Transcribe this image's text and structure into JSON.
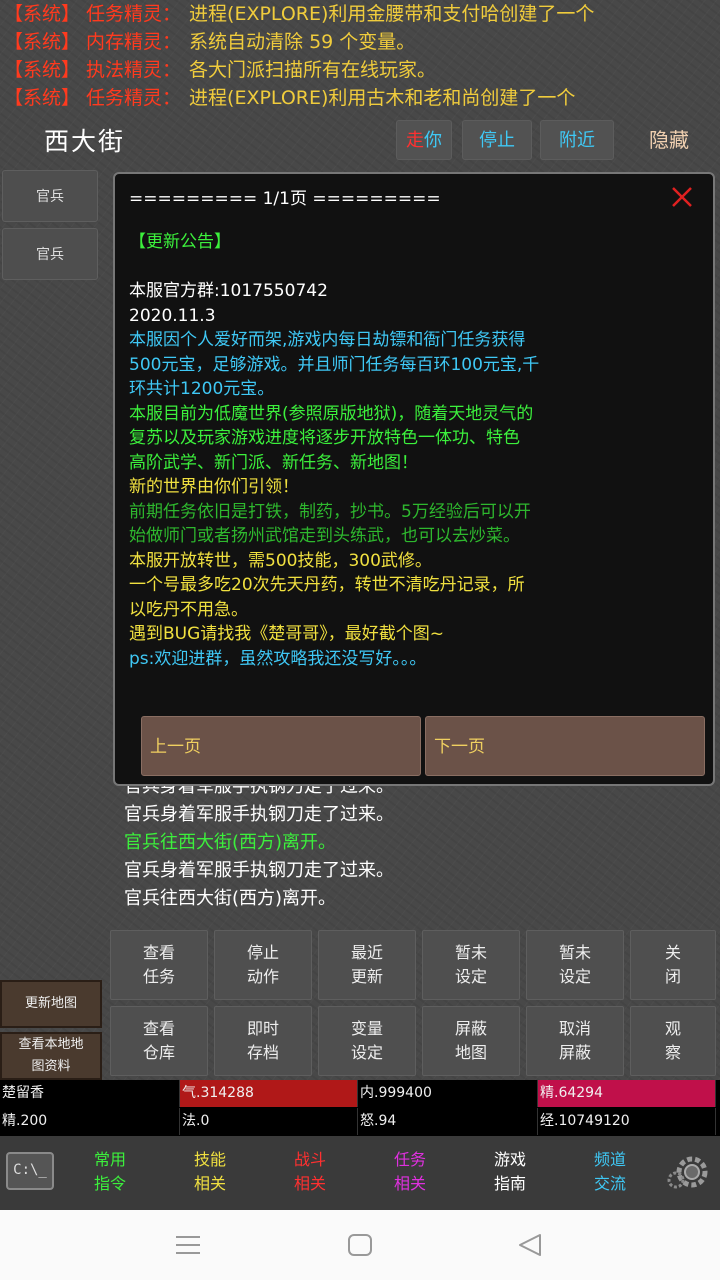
{
  "syslog": [
    {
      "tag": "【系统】",
      "who": "任务精灵：",
      "msg": "进程(EXPLORE)利用金腰带和支付哈创建了一个"
    },
    {
      "tag": "【系统】",
      "who": "内存精灵：",
      "msg": "系统自动清除 59 个变量。"
    },
    {
      "tag": "【系统】",
      "who": "执法精灵：",
      "msg": "各大门派扫描所有在线玩家。"
    },
    {
      "tag": "【系统】",
      "who": "任务精灵：",
      "msg": "进程(EXPLORE)利用古木和老和尚创建了一个"
    }
  ],
  "header": {
    "location": "西大街",
    "walk_a": "走",
    "walk_b": "你",
    "stop": "停止",
    "nearby": "附近",
    "hide": "隐藏"
  },
  "npcs": [
    "官兵",
    "官兵"
  ],
  "modal": {
    "page_header": "========= 1/1页 =========",
    "lines": [
      {
        "text": "【更新公告】",
        "color": "#3cf03c"
      },
      {
        "text": "",
        "color": ""
      },
      {
        "text": "本服官方群:1017550742",
        "color": "#ffffff"
      },
      {
        "text": "2020.11.3",
        "color": "#ffffff"
      },
      {
        "text": "本服因个人爱好而架,游戏内每日劫镖和衙门任务获得",
        "color": "#3fc8f5"
      },
      {
        "text": "500元宝，足够游戏。并且师门任务每百环100元宝,千",
        "color": "#3fc8f5"
      },
      {
        "text": "环共计1200元宝。",
        "color": "#3fc8f5"
      },
      {
        "text": "本服目前为低魔世界(参照原版地狱)，随着天地灵气的",
        "color": "#3cf03c"
      },
      {
        "text": "复苏以及玩家游戏进度将逐步开放特色一体功、特色",
        "color": "#3cf03c"
      },
      {
        "text": "高阶武学、新门派、新任务、新地图！",
        "color": "#3cf03c"
      },
      {
        "text": "新的世界由你们引领！",
        "color": "#f0e040"
      },
      {
        "text": "前期任务依旧是打铁，制药，抄书。5万经验后可以开",
        "color": "#2eb82e"
      },
      {
        "text": "始做师门或者扬州武馆走到头练武，也可以去炒菜。",
        "color": "#2eb82e"
      },
      {
        "text": "本服开放转世，需500技能，300武修。",
        "color": "#f0e040"
      },
      {
        "text": "一个号最多吃20次先天丹药，转世不清吃丹记录，所",
        "color": "#f0e040"
      },
      {
        "text": "以吃丹不用急。",
        "color": "#f0e040"
      },
      {
        "text": "遇到BUG请找我《楚哥哥》，最好截个图~",
        "color": "#f0e040"
      },
      {
        "text": "ps:欢迎进群，虽然攻略我还没写好。。。",
        "color": "#3fc8f5"
      }
    ],
    "prev": "上一页",
    "next": "下一页"
  },
  "chat": [
    {
      "text": "官兵身着军服手执钢刀走了过来。",
      "color": "#ffffff"
    },
    {
      "text": "官兵身着军服手执钢刀走了过来。",
      "color": "#ffffff"
    },
    {
      "text": "官兵往西大街(西方)离开。",
      "color": "#3cf03c"
    },
    {
      "text": "官兵身着军服手执钢刀走了过来。",
      "color": "#ffffff"
    },
    {
      "text": "官兵往西大街(西方)离开。",
      "color": "#ffffff"
    }
  ],
  "commands": [
    {
      "l1": "查看",
      "l2": "任务"
    },
    {
      "l1": "停止",
      "l2": "动作"
    },
    {
      "l1": "最近",
      "l2": "更新"
    },
    {
      "l1": "暂未",
      "l2": "设定"
    },
    {
      "l1": "暂未",
      "l2": "设定"
    },
    {
      "l1": "关",
      "l2": "闭"
    },
    {
      "l1": "查看",
      "l2": "仓库"
    },
    {
      "l1": "即时",
      "l2": "存档"
    },
    {
      "l1": "变量",
      "l2": "设定"
    },
    {
      "l1": "屏蔽",
      "l2": "地图"
    },
    {
      "l1": "取消",
      "l2": "屏蔽"
    },
    {
      "l1": "观",
      "l2": "察"
    }
  ],
  "side": {
    "update_map": "更新地图",
    "local_l1": "查看本地地",
    "local_l2": "图资料"
  },
  "stats": [
    {
      "text": "楚留香",
      "bg": "#000000"
    },
    {
      "text": "气.314288",
      "bg": "#b01818"
    },
    {
      "text": "内.999400",
      "bg": "#000000"
    },
    {
      "text": "精.64294",
      "bg": "#c0104a"
    },
    {
      "text": "精.200",
      "bg": "#000000"
    },
    {
      "text": "法.0",
      "bg": "#000000"
    },
    {
      "text": "怒.94",
      "bg": "#000000"
    },
    {
      "text": "经.10749120",
      "bg": "#000000"
    }
  ],
  "tabs": [
    {
      "l1": "常用",
      "l2": "指令",
      "color": "#3cf03c"
    },
    {
      "l1": "技能",
      "l2": "相关",
      "color": "#f0e040"
    },
    {
      "l1": "战斗",
      "l2": "相关",
      "color": "#ff3030"
    },
    {
      "l1": "任务",
      "l2": "相关",
      "color": "#e030e0"
    },
    {
      "l1": "游戏",
      "l2": "指南",
      "color": "#ffffff"
    },
    {
      "l1": "频道",
      "l2": "交流",
      "color": "#3fc8f5"
    }
  ],
  "cmd_icon_label": "C:\\_"
}
